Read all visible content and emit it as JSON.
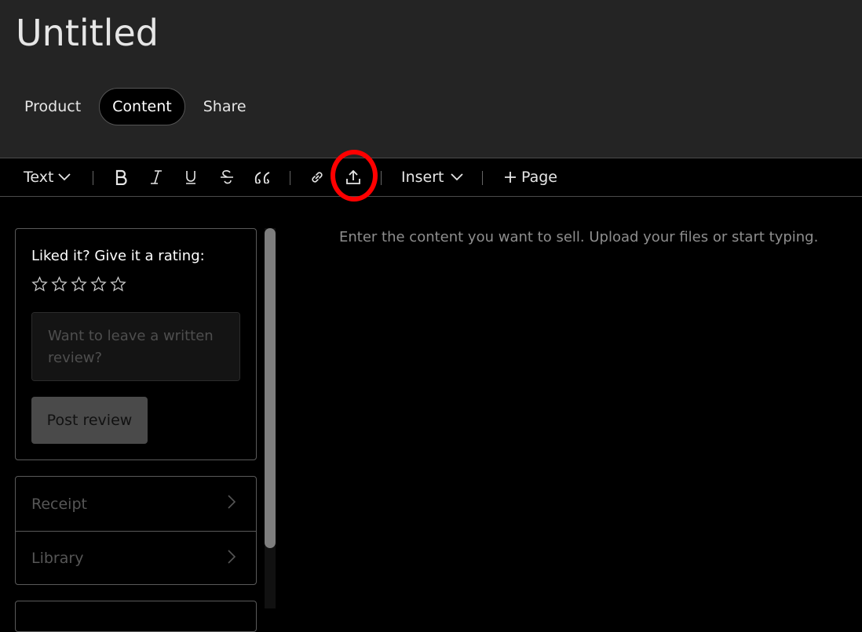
{
  "page": {
    "title": "Untitled"
  },
  "tabs": [
    {
      "label": "Product",
      "active": false
    },
    {
      "label": "Content",
      "active": true
    },
    {
      "label": "Share",
      "active": false
    }
  ],
  "toolbar": {
    "text_style": "Text",
    "insert_label": "Insert",
    "page_label": "Page",
    "icons": [
      "chevron-down-icon",
      "bold-icon",
      "italic-icon",
      "underline-icon",
      "strikethrough-icon",
      "quote-icon",
      "link-icon",
      "upload-icon",
      "plus-icon"
    ]
  },
  "highlight_color": "#ff0000",
  "sidebar": {
    "rating_title": "Liked it? Give it a rating:",
    "stars": 5,
    "review_placeholder": "Want to leave a written review?",
    "post_button": "Post review",
    "links": [
      {
        "label": "Receipt"
      },
      {
        "label": "Library"
      }
    ]
  },
  "editor": {
    "placeholder": "Enter the content you want to sell. Upload your files or start typing."
  }
}
